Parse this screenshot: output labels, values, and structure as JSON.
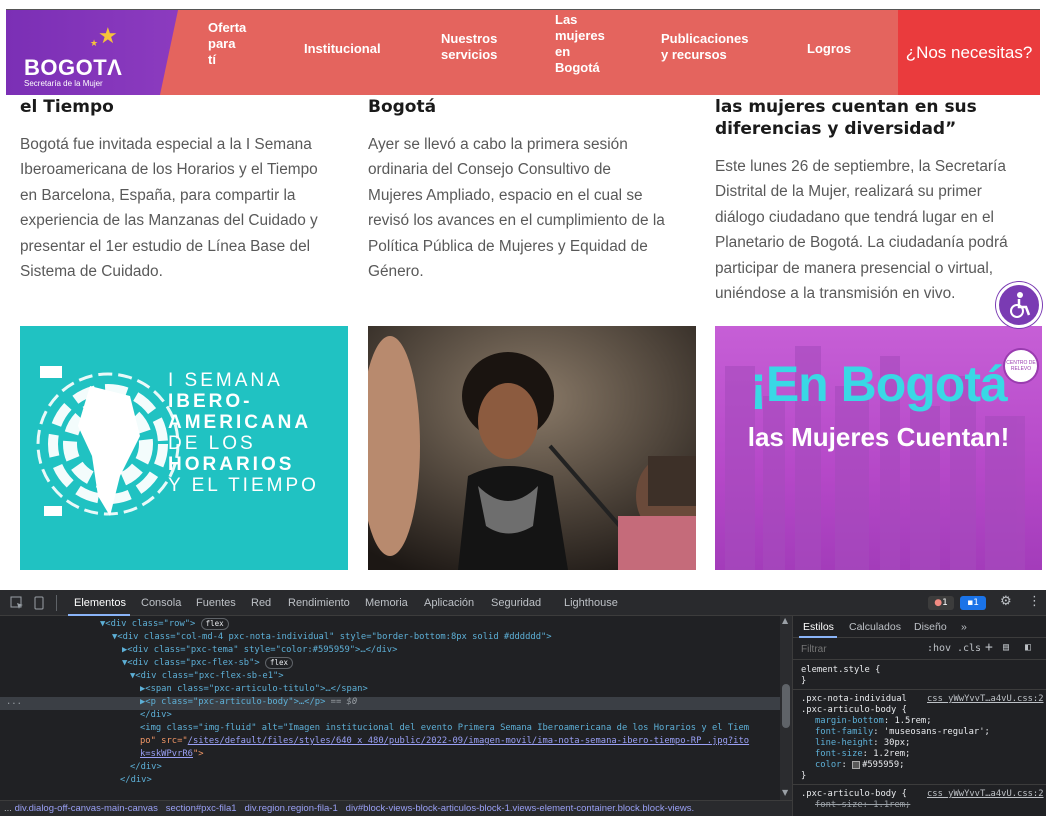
{
  "header": {
    "logo_text": "BOGOTΛ",
    "logo_subtitle": "Secretaría de la Mujer",
    "nav": [
      {
        "lines": [
          "Oferta",
          "para",
          "tí"
        ]
      },
      {
        "lines": [
          "Institucional"
        ]
      },
      {
        "lines": [
          "Nuestros",
          "servicios"
        ]
      },
      {
        "lines": [
          "Las",
          "mujeres",
          "en",
          "Bogotá"
        ]
      },
      {
        "lines": [
          "Publicaciones",
          "y recursos"
        ]
      },
      {
        "lines": [
          "Logros"
        ]
      }
    ],
    "help_label": "¿Nos necesitas?"
  },
  "articles": [
    {
      "title_lines": [
        "el Tiempo"
      ],
      "body_lines": [
        "Bogotá fue invitada especial a la I Semana",
        "Iberoamericana de los Horarios y el Tiempo",
        "en Barcelona, España, para compartir la",
        "experiencia de las Manzanas del Cuidado y",
        "presentar el 1er estudio de Línea Base del",
        "Sistema de Cuidado."
      ],
      "image": {
        "lines": [
          "I SEMANA",
          "IBERO-",
          "AMERICANA",
          "DE LOS",
          "HORARIOS",
          "Y EL TIEMPO"
        ]
      }
    },
    {
      "title_lines": [
        "Bogotá"
      ],
      "body_lines": [
        "Ayer se llevó a cabo la primera sesión",
        "ordinaria del Consejo Consultivo de",
        "Mujeres Ampliado, espacio en el cual se",
        "revisó los avances en el cumplimiento de la",
        "Política Pública de Mujeres y Equidad de",
        "Género."
      ]
    },
    {
      "title_lines": [
        "las mujeres cuentan en sus",
        "diferencias y diversidad”"
      ],
      "body_lines": [
        "Este lunes 26 de septiembre, la Secretaría",
        "Distrital de la Mujer, realizará su primer",
        "diálogo ciudadano que tendrá lugar en el",
        "Planetario de Bogotá. La ciudadanía podrá",
        "participar de manera presencial o virtual,",
        "uniéndose a la transmisión en vivo."
      ],
      "image": {
        "line1": "¡En Bogotá",
        "line2": "las Mujeres Cuentan!",
        "badge": "CENTRO DE RELEVO"
      }
    }
  ],
  "devtools": {
    "tabs": [
      "Elementos",
      "Consola",
      "Fuentes",
      "Red",
      "Rendimiento",
      "Memoria",
      "Aplicación",
      "Seguridad",
      "Lighthouse"
    ],
    "error_count": "1",
    "message_count": "1",
    "dom_lines": [
      {
        "t": "▼<div class=\"row\">",
        "badge": "flex"
      },
      {
        "t": "▼<div class=\"col-md-4 pxc-nota-individual\" style=\"border-bottom:8px solid #dddddd\">"
      },
      {
        "t": "▶<div class=\"pxc-tema\" style=\"color:#595959\">…</div>"
      },
      {
        "t": "▼<div class=\"pxc-flex-sb\">",
        "badge": "flex"
      },
      {
        "t": "▼<div class=\"pxc-flex-sb-e1\">"
      },
      {
        "t": "▶<span class=\"pxc-articulo-titulo\">…</span>"
      },
      {
        "t": "▶<p class=\"pxc-articulo-body\">…</p>",
        "suffix": " == $0"
      },
      {
        "t": "</div>"
      },
      {
        "t": "<img class=\"img-fluid\" alt=\"Imagen institucional del evento Primera Semana Iberoamericana de los Horarios y el Tiem"
      },
      {
        "t": "po\" src=\"",
        "link": "/sites/default/files/styles/640 x 480/public/2022-09/imagen-movil/ima-nota-semana-ibero-tiempo-RP .jpg?ito"
      },
      {
        "t": "",
        "link": "k=skWPvrR6",
        "after": "\">"
      },
      {
        "t": "</div>"
      },
      {
        "t": "</div>"
      }
    ],
    "breadcrumb": [
      "div.dialog-off-canvas-main-canvas",
      "section#pxc-fila1",
      "div.region.region-fila-1",
      "div#block-views-block-articulos-block-1.views-element-container.block.block-views."
    ],
    "breadcrumb_lead": "...",
    "styles": {
      "tabs": [
        "Estilos",
        "Calculados",
        "Diseño",
        "»"
      ],
      "filter_placeholder": "Filtrar",
      "hov_label": ":hov",
      "cls_label": ".cls",
      "element_style": "element.style {",
      "close_brace": "}",
      "rule1_selector": ".pxc-nota-individual",
      "rule1_source": "css_yWwYvvT…a4vU.css:2",
      "rule2_selector": ".pxc-articulo-body {",
      "rule2_props": [
        {
          "p": "margin-bottom",
          "v": "1.5rem;"
        },
        {
          "p": "font-family",
          "v": "'museosans-regular';"
        },
        {
          "p": "line-height",
          "v": "30px;"
        },
        {
          "p": "font-size",
          "v": "1.2rem;"
        },
        {
          "p": "color",
          "v": "#595959;",
          "swatch": "#595959"
        }
      ],
      "rule3_selector": ".pxc-articulo-body {",
      "rule3_source": "css_yWwYvvT…a4vU.css:2",
      "rule3_prop": "font-size: 1.1rem;"
    }
  }
}
